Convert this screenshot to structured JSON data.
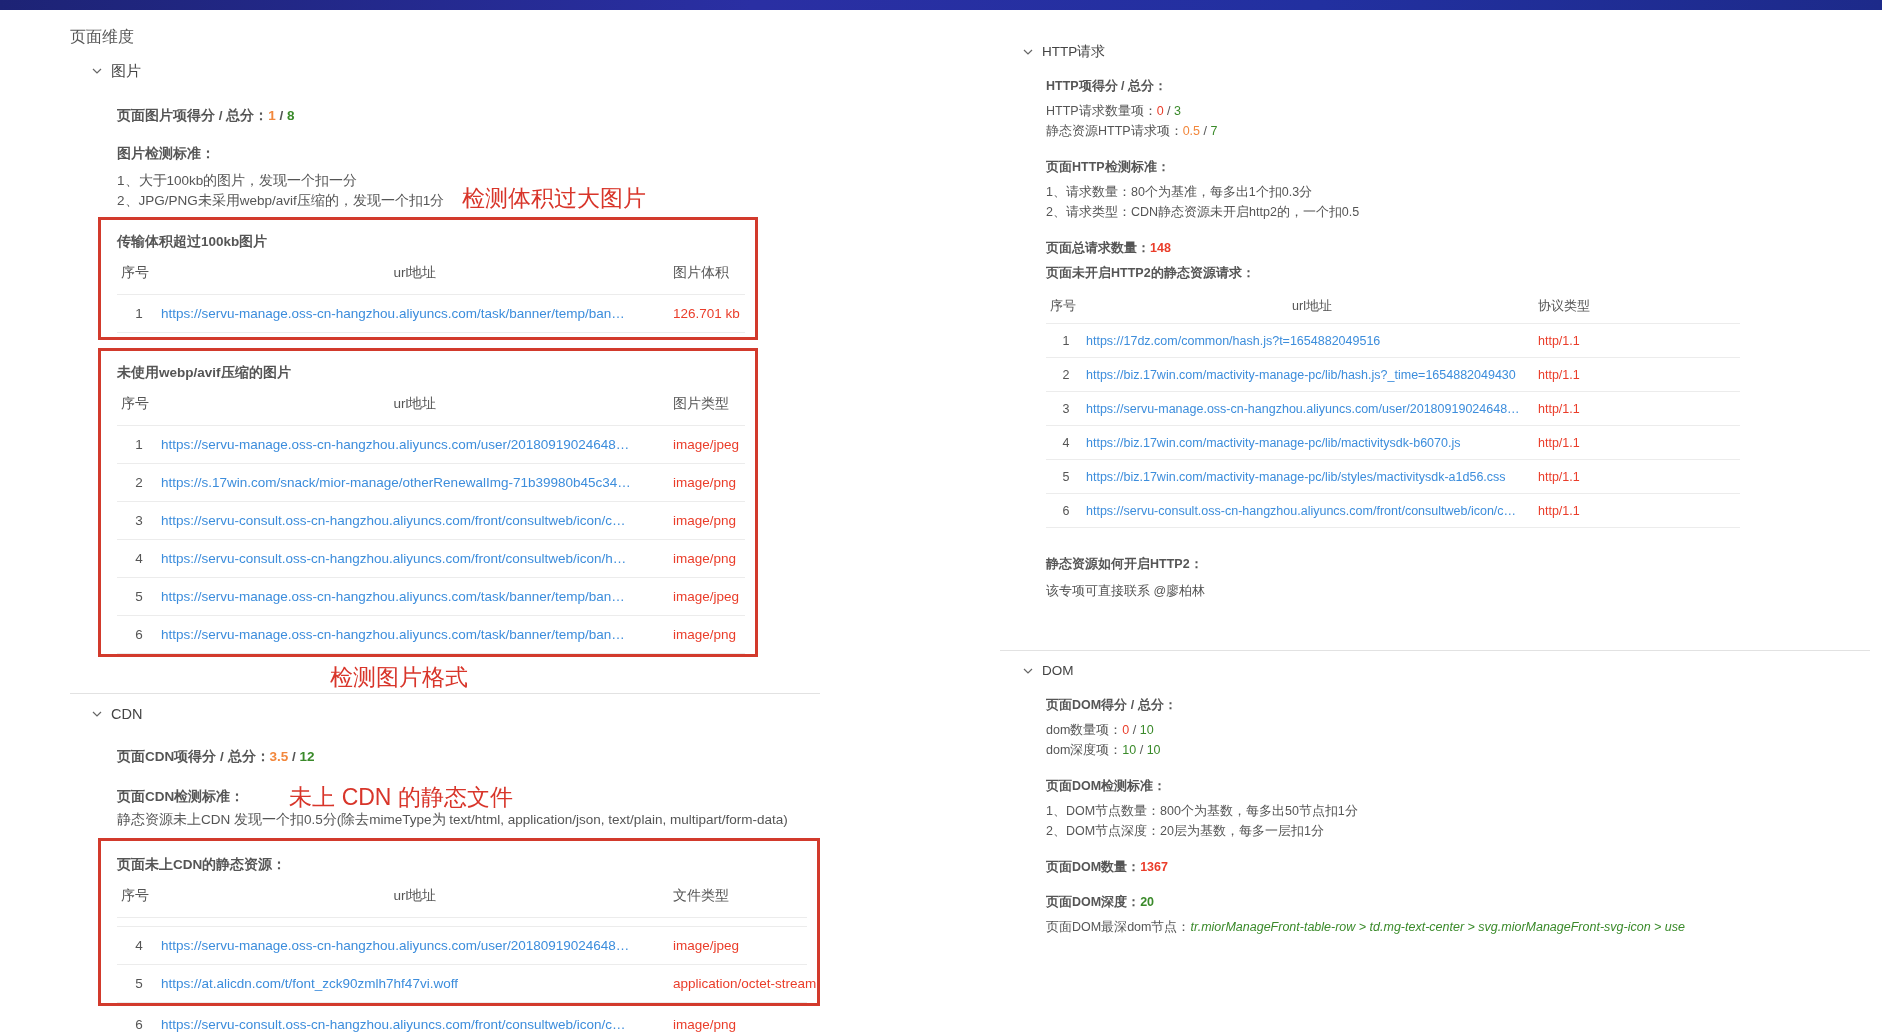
{
  "page_title": "页面维度",
  "images": {
    "title": "图片",
    "expanded": true,
    "score": {
      "label": "页面图片项得分 / 总分：",
      "score": "1",
      "color": "#f2873c",
      "sep": "/",
      "total": "8"
    },
    "criteria_title": "图片检测标准：",
    "criteria": [
      "1、大于100kb的图片，发现一个扣一分",
      "2、JPG/PNG未采用webp/avif压缩的，发现一个扣1分"
    ],
    "annotation_size": "检测体积过大图片",
    "oversize": {
      "title": "传输体积超过100kb图片",
      "columns": [
        "序号",
        "url地址",
        "图片体积"
      ],
      "rows": [
        {
          "index": "1",
          "url": "https://servu-manage.oss-cn-hangzhou.aliyuncs.com/task/banner/temp/ban…",
          "value": "126.701 kb"
        }
      ]
    },
    "format": {
      "title": "未使用webp/avif压缩的图片",
      "columns": [
        "序号",
        "url地址",
        "图片类型"
      ],
      "rows": [
        {
          "index": "1",
          "url": "https://servu-manage.oss-cn-hangzhou.aliyuncs.com/user/20180919024648…",
          "value": "image/jpeg"
        },
        {
          "index": "2",
          "url": "https://s.17win.com/snack/mior-manage/otherRenewalImg-71b39980b45c34…",
          "value": "image/png"
        },
        {
          "index": "3",
          "url": "https://servu-consult.oss-cn-hangzhou.aliyuncs.com/front/consultweb/icon/c…",
          "value": "image/png"
        },
        {
          "index": "4",
          "url": "https://servu-consult.oss-cn-hangzhou.aliyuncs.com/front/consultweb/icon/h…",
          "value": "image/png"
        },
        {
          "index": "5",
          "url": "https://servu-manage.oss-cn-hangzhou.aliyuncs.com/task/banner/temp/ban…",
          "value": "image/jpeg"
        },
        {
          "index": "6",
          "url": "https://servu-manage.oss-cn-hangzhou.aliyuncs.com/task/banner/temp/ban…",
          "value": "image/png"
        }
      ]
    },
    "annotation_format": "检测图片格式"
  },
  "cdn": {
    "title": "CDN",
    "expanded": true,
    "score": {
      "label": "页面CDN项得分 / 总分：",
      "score": "3.5",
      "color": "#f2873c",
      "sep": "/",
      "total": "12"
    },
    "criteria_title": "页面CDN检测标准：",
    "annotation": "未上 CDN 的静态文件",
    "criteria": [
      "静态资源未上CDN 发现一个扣0.5分(除去mimeType为 text/html, application/json, text/plain, multipart/form-data)"
    ],
    "resources": {
      "title": "页面未上CDN的静态资源：",
      "columns": [
        "序号",
        "url地址",
        "文件类型"
      ],
      "rows": [
        {
          "index": "4",
          "url": "https://servu-manage.oss-cn-hangzhou.aliyuncs.com/user/20180919024648…",
          "value": "image/jpeg"
        },
        {
          "index": "5",
          "url": "https://at.alicdn.com/t/font_zck90zmlh7hf47vi.woff",
          "value": "application/octet-stream"
        }
      ]
    },
    "rows_below": [
      {
        "index": "6",
        "url": "https://servu-consult.oss-cn-hangzhou.aliyuncs.com/front/consultweb/icon/c…",
        "value": "image/png"
      }
    ]
  },
  "http": {
    "title": "HTTP请求",
    "expanded": true,
    "score_title": "HTTP项得分 / 总分：",
    "scores": [
      {
        "label": "HTTP请求数量项：",
        "score": "0",
        "color": "#ea3d2a",
        "sep": "/",
        "total": "3"
      },
      {
        "label": "静态资源HTTP请求项：",
        "score": "0.5",
        "color": "#f2873c",
        "sep": "/",
        "total": "7"
      }
    ],
    "criteria_title": "页面HTTP检测标准：",
    "criteria": [
      "1、请求数量：80个为基准，每多出1个扣0.3分",
      "2、请求类型：CDN静态资源未开启http2的，一个扣0.5"
    ],
    "total": {
      "label": "页面总请求数量：",
      "value": "148",
      "color": "#ea3d2a"
    },
    "table": {
      "title": "页面未开启HTTP2的静态资源请求：",
      "columns": [
        "序号",
        "url地址",
        "协议类型"
      ],
      "rows": [
        {
          "index": "1",
          "url": "https://17dz.com/common/hash.js?t=1654882049516",
          "value": "http/1.1"
        },
        {
          "index": "2",
          "url": "https://biz.17win.com/mactivity-manage-pc/lib/hash.js?_time=1654882049430",
          "value": "http/1.1"
        },
        {
          "index": "3",
          "url": "https://servu-manage.oss-cn-hangzhou.aliyuncs.com/user/20180919024648…",
          "value": "http/1.1"
        },
        {
          "index": "4",
          "url": "https://biz.17win.com/mactivity-manage-pc/lib/mactivitysdk-b6070.js",
          "value": "http/1.1"
        },
        {
          "index": "5",
          "url": "https://biz.17win.com/mactivity-manage-pc/lib/styles/mactivitysdk-a1d56.css",
          "value": "http/1.1"
        },
        {
          "index": "6",
          "url": "https://servu-consult.oss-cn-hangzhou.aliyuncs.com/front/consultweb/icon/c…",
          "value": "http/1.1"
        }
      ]
    },
    "howto_title": "静态资源如何开启HTTP2：",
    "howto": "该专项可直接联系 @廖柏林"
  },
  "dom": {
    "title": "DOM",
    "expanded": true,
    "score_title": "页面DOM得分 / 总分：",
    "scores": [
      {
        "label": "dom数量项：",
        "score": "0",
        "color": "#ea3d2a",
        "sep": "/",
        "total": "10"
      },
      {
        "label": "dom深度项：",
        "score": "10",
        "color": "#3a8a2a",
        "sep": "/",
        "total": "10"
      }
    ],
    "criteria_title": "页面DOM检测标准：",
    "criteria": [
      "1、DOM节点数量：800个为基数，每多出50节点扣1分",
      "2、DOM节点深度：20层为基数，每多一层扣1分"
    ],
    "count": {
      "label": "页面DOM数量：",
      "value": "1367",
      "color": "#ea3d2a"
    },
    "depth": {
      "label": "页面DOM深度：",
      "value": "20",
      "color": "#3a8a2a"
    },
    "deepest": {
      "label": "页面DOM最深dom节点：",
      "value": "tr.miorManageFront-table-row > td.mg-text-center > svg.miorManageFront-svg-icon > use"
    }
  }
}
